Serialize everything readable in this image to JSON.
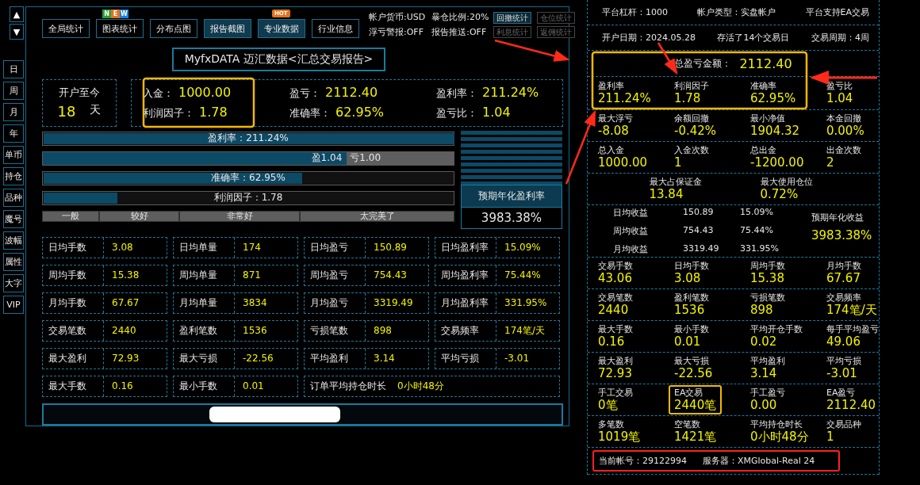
{
  "nav_arrows": [
    "▲",
    "▼"
  ],
  "side_tabs": [
    {
      "label": "日",
      "selected": false
    },
    {
      "label": "周",
      "selected": false
    },
    {
      "label": "月",
      "selected": false
    },
    {
      "label": "年",
      "selected": false
    },
    {
      "label": "单币",
      "selected": false
    },
    {
      "label": "持仓",
      "selected": false
    },
    {
      "label": "品种",
      "selected": false
    },
    {
      "label": "魔号",
      "selected": false
    },
    {
      "label": "波幅",
      "selected": false
    },
    {
      "label": "属性",
      "selected": false
    },
    {
      "label": "大字",
      "selected": false
    },
    {
      "label": "VIP",
      "selected": false
    }
  ],
  "toolbar": [
    {
      "label": "全局统计",
      "highlighted": false
    },
    {
      "label": "图表统计",
      "highlighted": false,
      "badges": [
        {
          "text": "N",
          "color": "#2e9e3a"
        },
        {
          "text": "E",
          "color": "#e8701a"
        },
        {
          "text": "W",
          "color": "#1e7ee0"
        }
      ]
    },
    {
      "label": "分布点图",
      "highlighted": false
    },
    {
      "label": "报告截图",
      "highlighted": true
    },
    {
      "label": "专业数据",
      "highlighted": true,
      "hot": "HOT"
    },
    {
      "label": "行业信息",
      "highlighted": false
    }
  ],
  "account_info": [
    "帐户货币:USD",
    "暴仓比例:20%",
    "浮亏警报:OFF",
    "报告推送:OFF"
  ],
  "stat_buttons": [
    {
      "label": "回撤统计",
      "disabled": false
    },
    {
      "label": "仓位统计",
      "disabled": true
    },
    {
      "label": "利息统计",
      "disabled": true
    },
    {
      "label": "返佣统计",
      "disabled": true
    }
  ],
  "report_title": "MyfxDATA 迈汇数据<汇总交易报告>",
  "since_open": {
    "label": "开户至今",
    "value": "18",
    "unit": "天"
  },
  "summary": [
    [
      {
        "label": "入金：",
        "value": "1000.00"
      },
      {
        "label": "利润因子：",
        "value": "1.78"
      }
    ],
    [
      {
        "label": "盈亏：",
        "value": "2112.40"
      },
      {
        "label": "准确率：",
        "value": "62.95%"
      }
    ],
    [
      {
        "label": "盈利率：",
        "value": "211.24%"
      },
      {
        "label": "盈亏比：",
        "value": "1.04"
      }
    ]
  ],
  "bars": [
    {
      "kind": "single",
      "label": "盈利率：211.24%",
      "level": 1
    },
    {
      "kind": "split",
      "label": "盈1.04",
      "rest_label": "亏1.00",
      "level": 0.74
    },
    {
      "kind": "single",
      "label": "准确率：62.95%",
      "level": 0.63
    },
    {
      "kind": "single",
      "label": "利润因子：1.78",
      "level": 0.18
    }
  ],
  "scale": [
    "一般",
    "较好",
    "非常好",
    "太完美了"
  ],
  "annual": {
    "label": "预期年化盈利率",
    "value": "3983.38%"
  },
  "grid_rows": [
    [
      {
        "label": "日均手数",
        "value": "3.08"
      },
      {
        "label": "日均单量",
        "value": "174"
      },
      {
        "label": "日均盈亏",
        "value": "150.89"
      },
      {
        "label": "日均盈利率",
        "value": "15.09%"
      }
    ],
    [
      {
        "label": "周均手数",
        "value": "15.38"
      },
      {
        "label": "周均单量",
        "value": "871"
      },
      {
        "label": "周均盈亏",
        "value": "754.43"
      },
      {
        "label": "周均盈利率",
        "value": "75.44%"
      }
    ],
    [
      {
        "label": "月均手数",
        "value": "67.67"
      },
      {
        "label": "月均单量",
        "value": "3834"
      },
      {
        "label": "月均盈亏",
        "value": "3319.49"
      },
      {
        "label": "月均盈利率",
        "value": "331.95%"
      }
    ],
    [
      {
        "label": "交易笔数",
        "value": "2440"
      },
      {
        "label": "盈利笔数",
        "value": "1536"
      },
      {
        "label": "亏损笔数",
        "value": "898"
      },
      {
        "label": "交易频率",
        "value": "174笔/天"
      }
    ],
    [
      {
        "label": "最大盈利",
        "value": "72.93"
      },
      {
        "label": "最大亏损",
        "value": "-22.56"
      },
      {
        "label": "平均盈利",
        "value": "3.14"
      },
      {
        "label": "平均亏损",
        "value": "-3.01"
      }
    ],
    [
      {
        "label": "最大手数",
        "value": "0.16"
      },
      {
        "label": "最小手数",
        "value": "0.01"
      },
      {
        "kind": "wide",
        "label": "订单平均持仓时长",
        "value": "0小时48分"
      }
    ]
  ],
  "right": {
    "info_rows": [
      [
        "平台杠杆：1000",
        "帐户类型：实盘帐户",
        "平台支持EA交易"
      ],
      [
        "开户日期：2024.05.28",
        "存活了14个交易日",
        "交易周期：4周"
      ]
    ],
    "total": {
      "label": "总盈亏金额：",
      "value": "2112.40"
    },
    "sections": [
      {
        "kind": "metrics",
        "cells": [
          {
            "label": "盈利率",
            "value": "211.24%"
          },
          {
            "label": "利润因子",
            "value": "1.78"
          },
          {
            "label": "准确率",
            "value": "62.95%"
          },
          {
            "label": "盈亏比",
            "value": "1.04"
          }
        ]
      },
      {
        "kind": "metrics",
        "cells": [
          {
            "label": "最大浮亏",
            "value": "-8.08"
          },
          {
            "label": "余额回撤",
            "value": "-0.42%"
          },
          {
            "label": "最小净值",
            "value": "1904.32"
          },
          {
            "label": "本金回撤",
            "value": "0.00%"
          }
        ]
      },
      {
        "kind": "metrics",
        "cells": [
          {
            "label": "总入金",
            "value": "1000.00"
          },
          {
            "label": "入金次数",
            "value": "1"
          },
          {
            "label": "总出金",
            "value": "-1200.00"
          },
          {
            "label": "出金次数",
            "value": "2"
          }
        ]
      },
      {
        "kind": "centered",
        "cells": [
          {
            "label": "最大占保证金",
            "value": "13.84"
          },
          {
            "label": "最大使用仓位",
            "value": "0.72%"
          }
        ]
      },
      {
        "kind": "income",
        "rows": [
          [
            "日均收益",
            "150.89",
            "15.09%"
          ],
          [
            "周均收益",
            "754.43",
            "75.44%"
          ],
          [
            "月均收益",
            "3319.49",
            "331.95%"
          ]
        ],
        "annual_label": "预期年化收益",
        "annual_value": "3983.38%"
      },
      {
        "kind": "metrics",
        "cells": [
          {
            "label": "交易手数",
            "value": "43.06"
          },
          {
            "label": "日均手数",
            "value": "3.08"
          },
          {
            "label": "周均手数",
            "value": "15.38"
          },
          {
            "label": "月均手数",
            "value": "67.67"
          }
        ]
      },
      {
        "kind": "metrics",
        "cells": [
          {
            "label": "交易笔数",
            "value": "2440"
          },
          {
            "label": "盈利笔数",
            "value": "1536"
          },
          {
            "label": "亏损笔数",
            "value": "898"
          },
          {
            "label": "交易频率",
            "value": "174笔/天"
          }
        ]
      },
      {
        "kind": "metrics",
        "cells": [
          {
            "label": "最大手数",
            "value": "0.16"
          },
          {
            "label": "最小手数",
            "value": "0.01"
          },
          {
            "label": "平均开仓手数",
            "value": "0.02"
          },
          {
            "label": "每手平均盈亏",
            "value": "49.06"
          }
        ]
      },
      {
        "kind": "metrics",
        "cells": [
          {
            "label": "最大盈利",
            "value": "72.93"
          },
          {
            "label": "最大亏损",
            "value": "-22.56"
          },
          {
            "label": "平均盈利",
            "value": "3.14"
          },
          {
            "label": "平均亏损",
            "value": "-3.01"
          }
        ]
      },
      {
        "kind": "metrics",
        "cells": [
          {
            "label": "手工交易",
            "value": "0笔"
          },
          {
            "label": "EA交易",
            "value": "2440笔",
            "highlighted": true
          },
          {
            "label": "手工盈亏",
            "value": "0.00"
          },
          {
            "label": "EA盈亏",
            "value": "2112.40"
          }
        ]
      },
      {
        "kind": "metrics",
        "cells": [
          {
            "label": "多笔数",
            "value": "1019笔"
          },
          {
            "label": "空笔数",
            "value": "1421笔"
          },
          {
            "label": "平均持仓时长",
            "value": "0小时48分"
          },
          {
            "label": "交易品种",
            "value": "1"
          }
        ]
      }
    ],
    "footer": [
      "当前帐号：29122994",
      "服务器：XMGlobal-Real 24"
    ]
  }
}
